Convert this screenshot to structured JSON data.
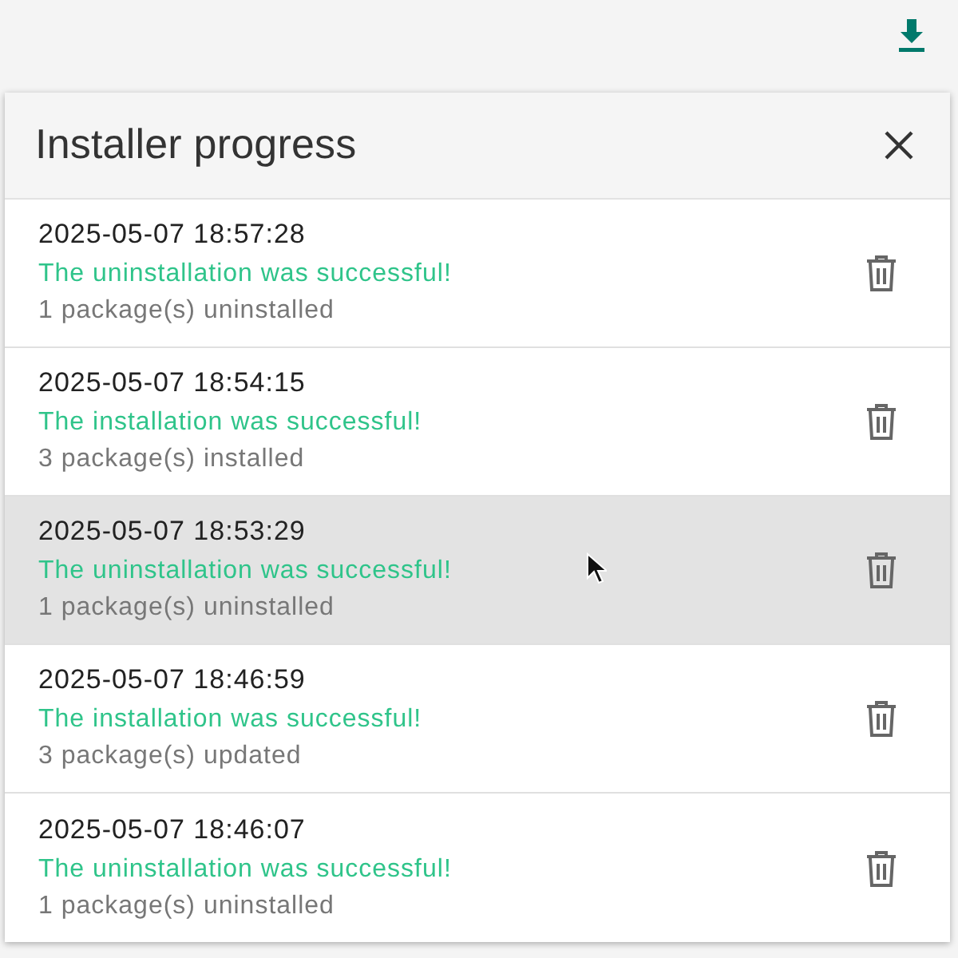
{
  "dialog": {
    "title": "Installer progress"
  },
  "entries": [
    {
      "timestamp": "2025-05-07 18:57:28",
      "message": "The uninstallation was successful!",
      "detail": "1 package(s) uninstalled",
      "hovered": false
    },
    {
      "timestamp": "2025-05-07 18:54:15",
      "message": "The installation was successful!",
      "detail": "3 package(s) installed",
      "hovered": false
    },
    {
      "timestamp": "2025-05-07 18:53:29",
      "message": "The uninstallation was successful!",
      "detail": "1 package(s) uninstalled",
      "hovered": true
    },
    {
      "timestamp": "2025-05-07 18:46:59",
      "message": "The installation was successful!",
      "detail": "3 package(s) updated",
      "hovered": false
    },
    {
      "timestamp": "2025-05-07 18:46:07",
      "message": "The uninstallation was successful!",
      "detail": "1 package(s) uninstalled",
      "hovered": false
    }
  ]
}
